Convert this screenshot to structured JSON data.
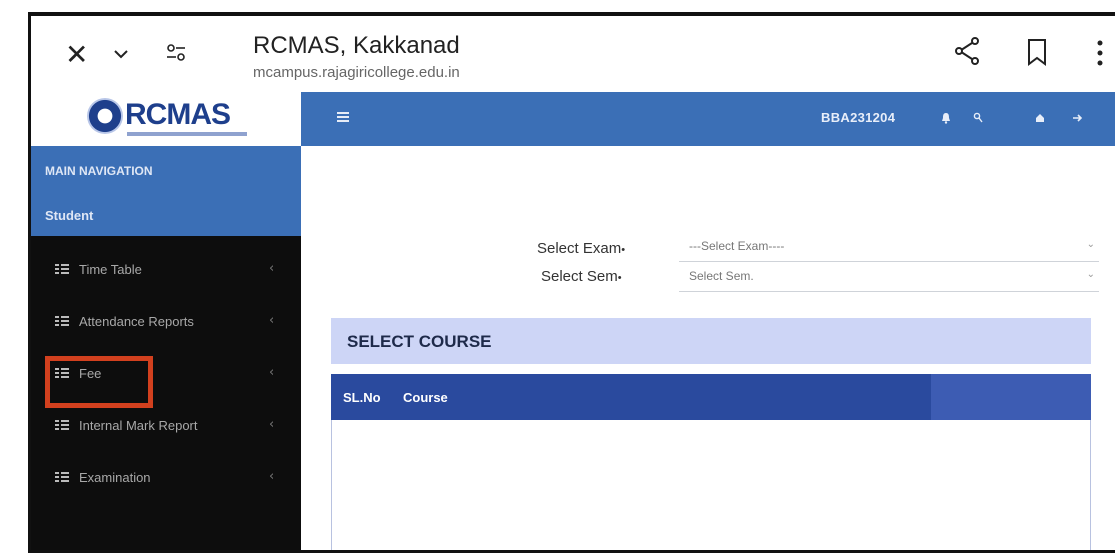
{
  "browser": {
    "title": "RCMAS, Kakkanad",
    "url": "mcampus.rajagiricollege.edu.in"
  },
  "sidebar": {
    "logo_text": "RCMAS",
    "nav_header": "MAIN NAVIGATION",
    "section": "Student",
    "items": [
      {
        "label": "Time Table"
      },
      {
        "label": "Attendance Reports"
      },
      {
        "label": "Fee"
      },
      {
        "label": "Internal Mark Report"
      },
      {
        "label": "Examination"
      }
    ],
    "chevron": "‹"
  },
  "appbar": {
    "user_id": "BBA231204",
    "icons": [
      "menu-icon",
      "bell-icon",
      "search-icon",
      "home-icon",
      "logout-icon"
    ]
  },
  "form": {
    "exam_label": "Select Exam",
    "exam_value": "---Select Exam----",
    "sem_label": "Select Sem",
    "sem_value": "Select Sem."
  },
  "course": {
    "title": "SELECT COURSE",
    "columns": [
      "SL.No",
      "Course"
    ]
  },
  "colors": {
    "accent_blue": "#3b6fb6",
    "sidebar_bg": "#0d0d0d",
    "highlight": "#d2401e",
    "course_header": "#cdd5f6",
    "table_header": "#2a4a9e"
  }
}
